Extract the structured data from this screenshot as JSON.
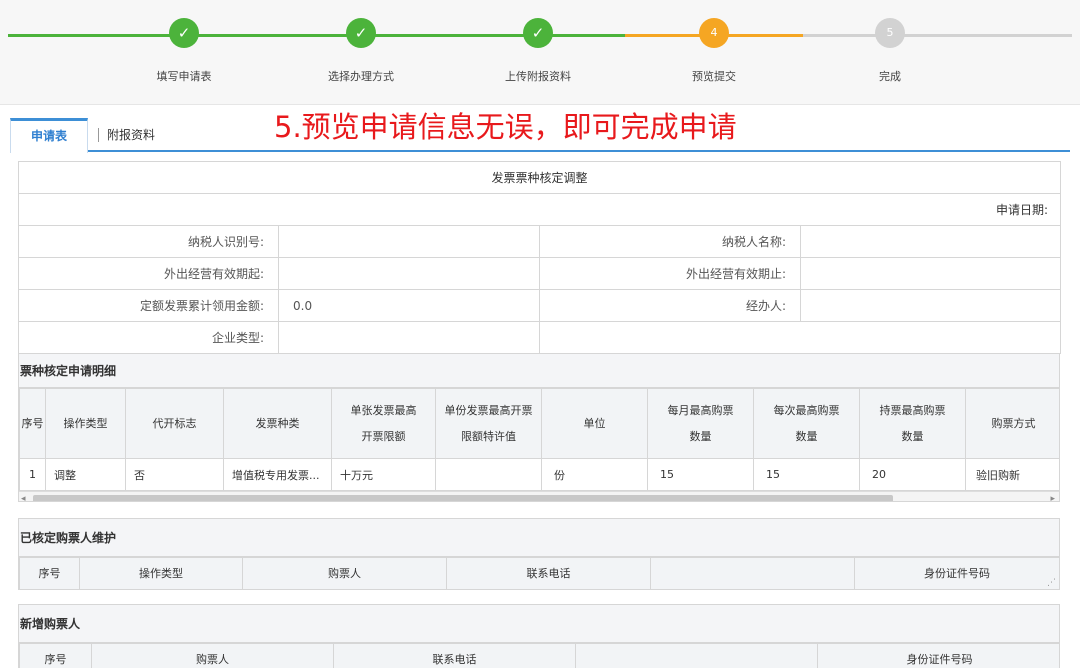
{
  "steps": [
    {
      "label": "填写申请表",
      "mark": "✓",
      "state": "done"
    },
    {
      "label": "选择办理方式",
      "mark": "✓",
      "state": "done"
    },
    {
      "label": "上传附报资料",
      "mark": "✓",
      "state": "done"
    },
    {
      "label": "预览提交",
      "mark": "4",
      "state": "current"
    },
    {
      "label": "完成",
      "mark": "5",
      "state": "todo"
    }
  ],
  "colors": {
    "done": "#4cb33b",
    "current": "#f5a623",
    "todo": "#d2d2d2",
    "accent": "#3d8fd6",
    "annotation": "#e8191c"
  },
  "annotation": "5.预览申请信息无误，即可完成申请",
  "tabs": [
    {
      "label": "申请表",
      "active": true
    },
    {
      "label": "附报资料",
      "active": false
    }
  ],
  "form": {
    "title": "发票票种核定调整",
    "apply_date_label": "申请日期:",
    "apply_date_value": "",
    "taxpayer_id_label": "纳税人识别号:",
    "taxpayer_id_value": "",
    "taxpayer_name_label": "纳税人名称:",
    "taxpayer_name_value": "",
    "valid_from_label": "外出经营有效期起:",
    "valid_from_value": "",
    "valid_to_label": "外出经营有效期止:",
    "valid_to_value": "",
    "quota_label": "定额发票累计领用金额:",
    "quota_value": "0.0",
    "handler_label": "经办人:",
    "handler_value": "",
    "company_type_label": "企业类型:",
    "company_type_value": ""
  },
  "detail": {
    "title": "票种核定申请明细",
    "headers": [
      "序号",
      "操作类型",
      "代开标志",
      "发票种类",
      "单张发票最高开票限额",
      "单份发票最高开票限额特许值",
      "单位",
      "每月最高购票数量",
      "每次最高购票数量",
      "持票最高购票数量",
      "购票方式"
    ],
    "rows": [
      [
        "1",
        "调整",
        "否",
        "增值税专用发票...",
        "十万元",
        "",
        "份",
        "15",
        "15",
        "20",
        "验旧购新"
      ]
    ],
    "scroll_left": "◂",
    "scroll_right": "▸"
  },
  "buyers": {
    "title": "已核定购票人维护",
    "headers": [
      "序号",
      "操作类型",
      "购票人",
      "联系电话",
      "",
      "身份证件号码"
    ]
  },
  "new_buyers": {
    "title": "新增购票人",
    "headers": [
      "序号",
      "购票人",
      "联系电话",
      "",
      "身份证件号码"
    ]
  },
  "icons": {
    "check": "check-icon",
    "resize": "resize-grip-icon"
  }
}
